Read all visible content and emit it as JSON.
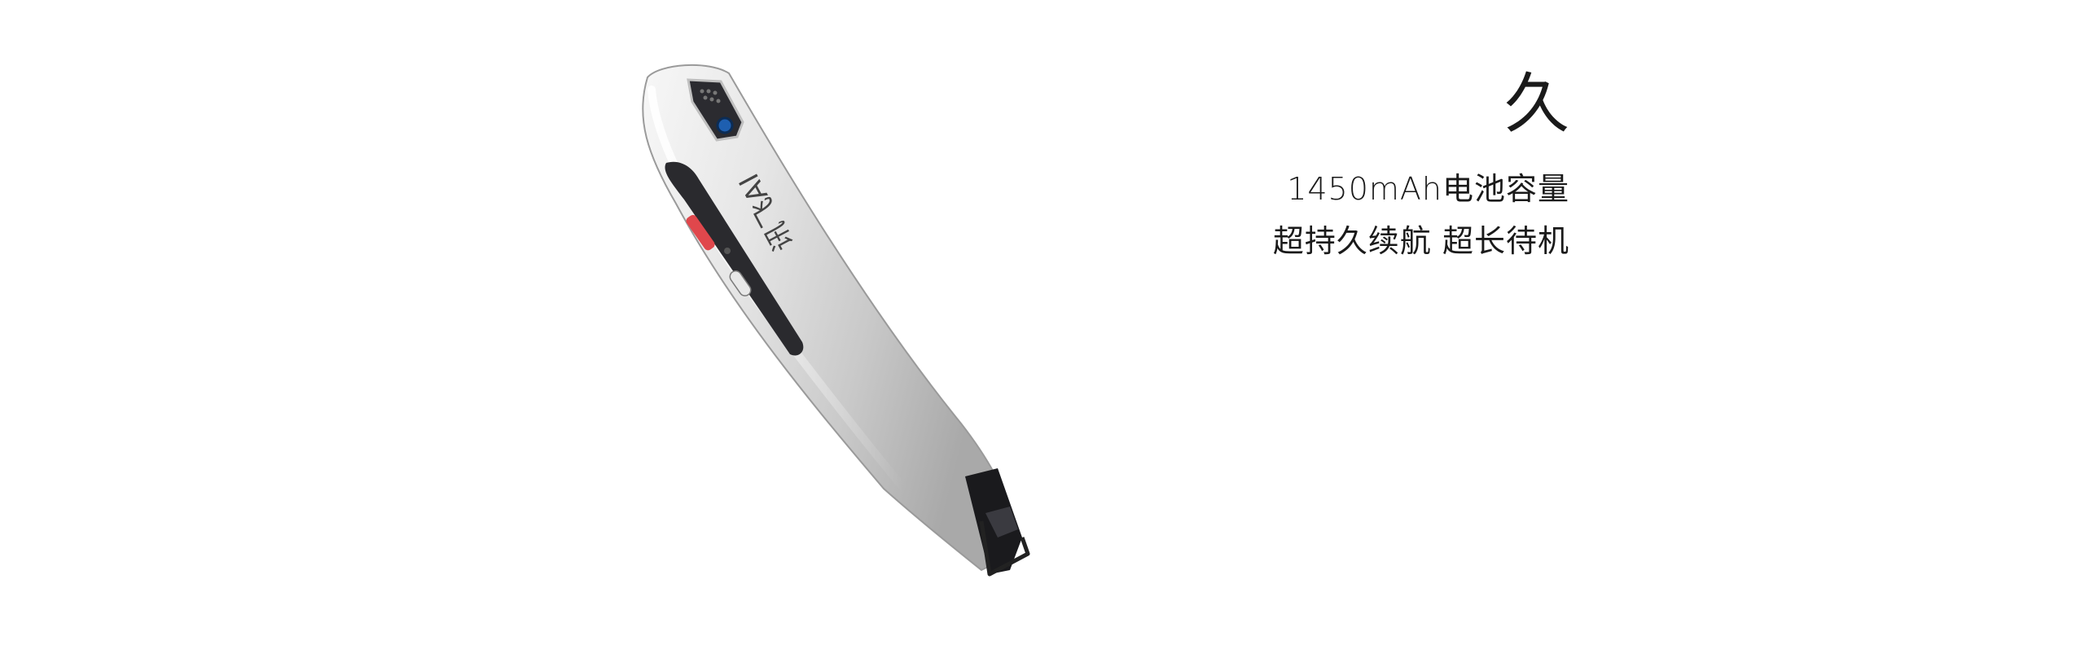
{
  "headline": "久",
  "lines": [
    "1450mAh电池容量",
    "超持久续航 超长待机"
  ],
  "product": {
    "logo_text": "讯飞AI",
    "body_color": "#d9d9d9",
    "accent_color": "#e0474c"
  }
}
